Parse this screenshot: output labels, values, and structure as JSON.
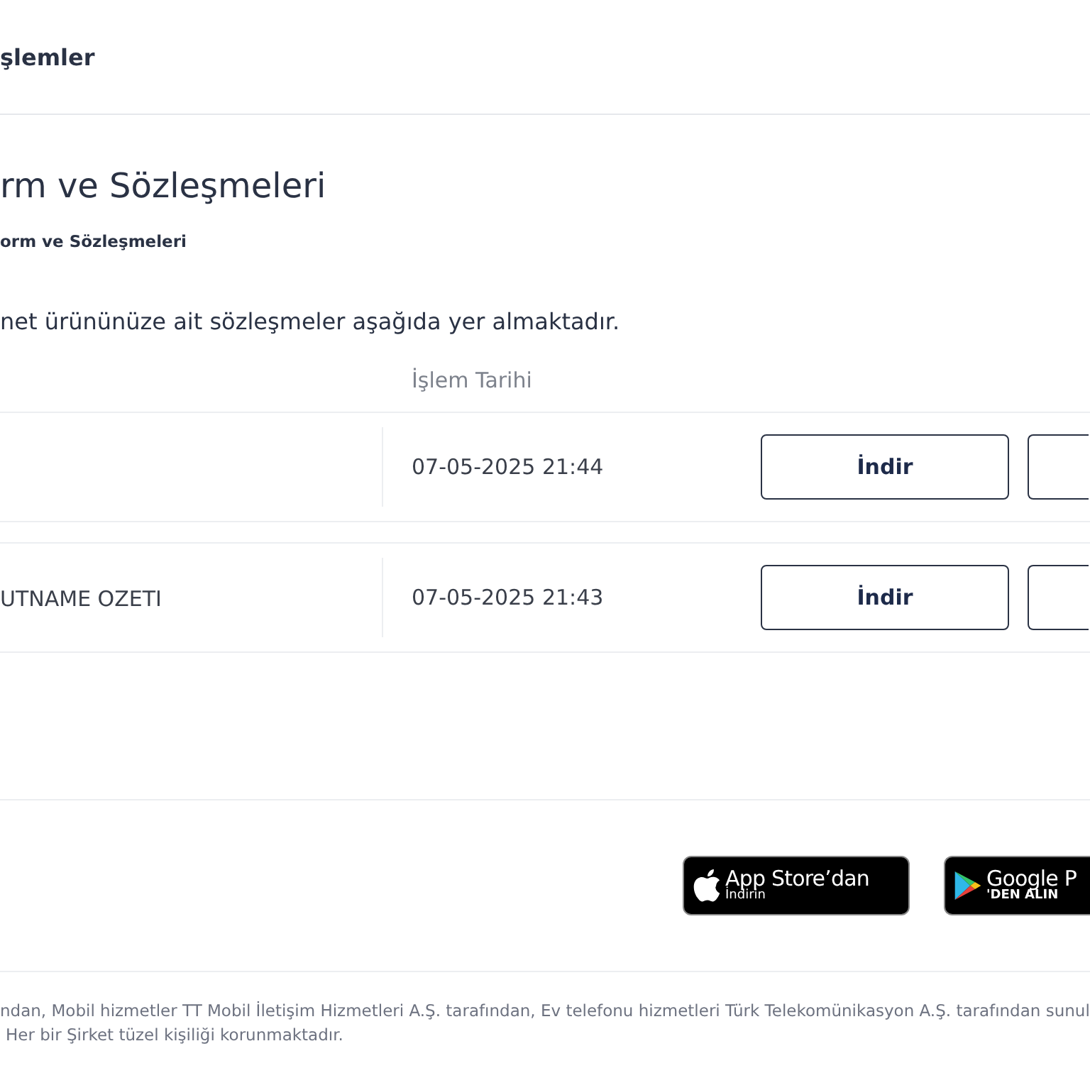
{
  "header": {
    "title": "şlemler"
  },
  "page": {
    "title": "rm ve Sözleşmeleri",
    "breadcrumb": "orm ve Sözleşmeleri",
    "description": "net ürününüze ait sözleşmeler aşağıda yer almaktadır."
  },
  "table": {
    "columns": [
      "İşlem Tarihi"
    ],
    "rows": [
      {
        "name": "",
        "date": "07-05-2025 21:44",
        "action": "İndir"
      },
      {
        "name": "UTNAME OZETI",
        "date": "07-05-2025 21:43",
        "action": "İndir"
      }
    ]
  },
  "app_badges": [
    {
      "kind": "apple",
      "title": "App Store’dan",
      "subtitle": "İndirin"
    },
    {
      "kind": "google",
      "title": "Google P",
      "subtitle": "'DEN ALIN"
    }
  ],
  "footer": {
    "lines": [
      "ndan, Mobil hizmetler TT Mobil İletişim Hizmetleri A.Ş. tarafından, Ev telefonu hizmetleri Türk Telekomünikasyon A.Ş. tarafından sunul",
      "Her bir Şirket tüzel kişiliği korunmaktadır."
    ]
  }
}
